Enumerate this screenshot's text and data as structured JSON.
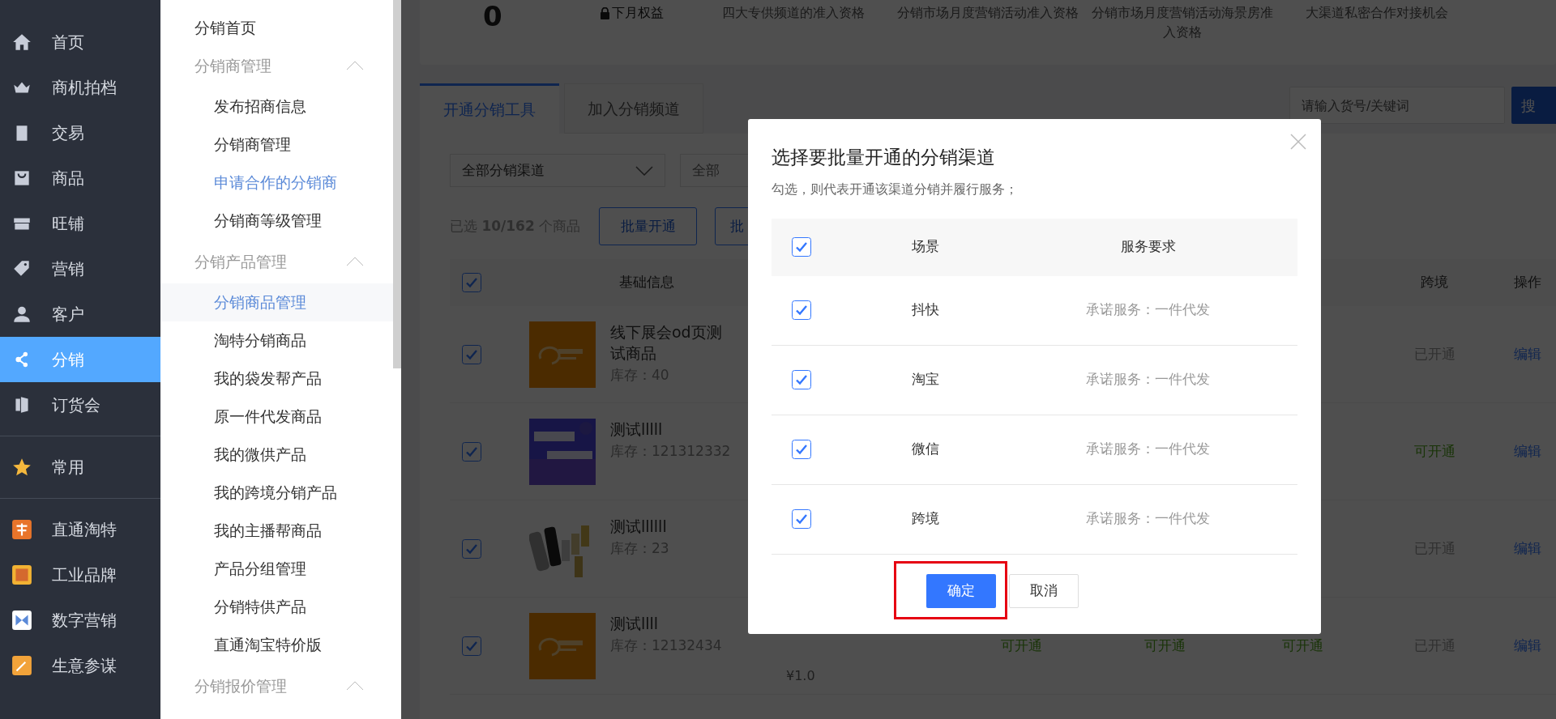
{
  "sidebar": {
    "items": [
      {
        "label": "首页",
        "selected": false
      },
      {
        "label": "商机拍档",
        "selected": false
      },
      {
        "label": "交易",
        "selected": false
      },
      {
        "label": "商品",
        "selected": false
      },
      {
        "label": "旺铺",
        "selected": false
      },
      {
        "label": "营销",
        "selected": false
      },
      {
        "label": "客户",
        "selected": false
      },
      {
        "label": "分销",
        "selected": true
      },
      {
        "label": "订货会",
        "selected": false
      },
      {
        "label": "常用",
        "selected": false
      },
      {
        "label": "直通淘特",
        "selected": false
      },
      {
        "label": "工业品牌",
        "selected": false
      },
      {
        "label": "数字营销",
        "selected": false
      },
      {
        "label": "生意参谋",
        "selected": false
      }
    ]
  },
  "submenu": {
    "items": [
      {
        "kind": "link",
        "label": "分销首页"
      },
      {
        "kind": "group",
        "label": "分销商管理",
        "expanded": true,
        "children": [
          {
            "label": "发布招商信息",
            "selected": false,
            "highlighted": false
          },
          {
            "label": "分销商管理",
            "selected": false,
            "highlighted": false
          },
          {
            "label": "申请合作的分销商",
            "selected": false,
            "highlighted": true
          },
          {
            "label": "分销商等级管理",
            "selected": false,
            "highlighted": false
          }
        ]
      },
      {
        "kind": "group",
        "label": "分销产品管理",
        "expanded": true,
        "children": [
          {
            "label": "分销商品管理",
            "selected": true,
            "highlighted": false
          },
          {
            "label": "淘特分销商品",
            "selected": false,
            "highlighted": false
          },
          {
            "label": "我的袋发帮产品",
            "selected": false,
            "highlighted": false
          },
          {
            "label": "原一件代发商品",
            "selected": false,
            "highlighted": false
          },
          {
            "label": "我的微供产品",
            "selected": false,
            "highlighted": false
          },
          {
            "label": "我的跨境分销产品",
            "selected": false,
            "highlighted": false
          },
          {
            "label": "我的主播帮商品",
            "selected": false,
            "highlighted": false
          },
          {
            "label": "产品分组管理",
            "selected": false,
            "highlighted": false
          },
          {
            "label": "分销特供产品",
            "selected": false,
            "highlighted": false
          },
          {
            "label": "直通淘宝特价版",
            "selected": false,
            "highlighted": false
          }
        ]
      },
      {
        "kind": "group",
        "label": "分销报价管理",
        "expanded": true
      }
    ]
  },
  "stats": {
    "value": "0",
    "locked_label": "下月权益",
    "benefits": [
      "四大专供频道的准入资格",
      "分销市场月度营销活动准入资格",
      "分销市场月度营销活动海景房准入资格",
      "大渠道私密合作对接机会"
    ]
  },
  "tabs": [
    {
      "label": "开通分销工具",
      "selected": true
    },
    {
      "label": "加入分销频道",
      "selected": false
    }
  ],
  "search": {
    "placeholder": "请输入货号/关键词",
    "button": "搜"
  },
  "filters": {
    "channel": "全部分销渠道",
    "second": "全部"
  },
  "selection": {
    "text": "已选 **10/162** 个商品",
    "buttons": [
      "批量开通",
      "批"
    ]
  },
  "table": {
    "columns": [
      "基础信息",
      "跨境",
      "操作"
    ],
    "header_checked": true,
    "rows": [
      {
        "checked": true,
        "name": "线下展会od页测试商品",
        "stock": "库存：40",
        "cross_border": "已开通",
        "available": false,
        "action": "编辑"
      },
      {
        "checked": true,
        "name": "测试lllll",
        "stock": "库存：121312332",
        "cross_border": "可开通",
        "available": true,
        "action": "编辑"
      },
      {
        "checked": true,
        "name": "测试llllll",
        "stock": "库存：23",
        "cross_border": "已开通",
        "available": false,
        "action": "编辑"
      },
      {
        "checked": true,
        "name": "测试llll",
        "stock": "库存：12132434",
        "price": "¥1.0",
        "channels": [
          "可开通",
          "可开通",
          "可开通"
        ],
        "cross_border": "已开通",
        "available": false,
        "action": "编辑"
      }
    ]
  },
  "dialog": {
    "title": "选择要批量开通的分销渠道",
    "subtitle": "勾选，则代表开通该渠道分销并履行服务；",
    "columns": [
      "场景",
      "服务要求"
    ],
    "header_checked": true,
    "rows": [
      {
        "checked": true,
        "scene": "抖快",
        "requirement": "承诺服务：一件代发"
      },
      {
        "checked": true,
        "scene": "淘宝",
        "requirement": "承诺服务：一件代发"
      },
      {
        "checked": true,
        "scene": "微信",
        "requirement": "承诺服务：一件代发"
      },
      {
        "checked": true,
        "scene": "跨境",
        "requirement": "承诺服务：一件代发"
      }
    ],
    "buttons": [
      {
        "label": "确定",
        "kind": "primary",
        "highlighted": true
      },
      {
        "label": "取消",
        "kind": "default",
        "highlighted": false
      }
    ]
  }
}
